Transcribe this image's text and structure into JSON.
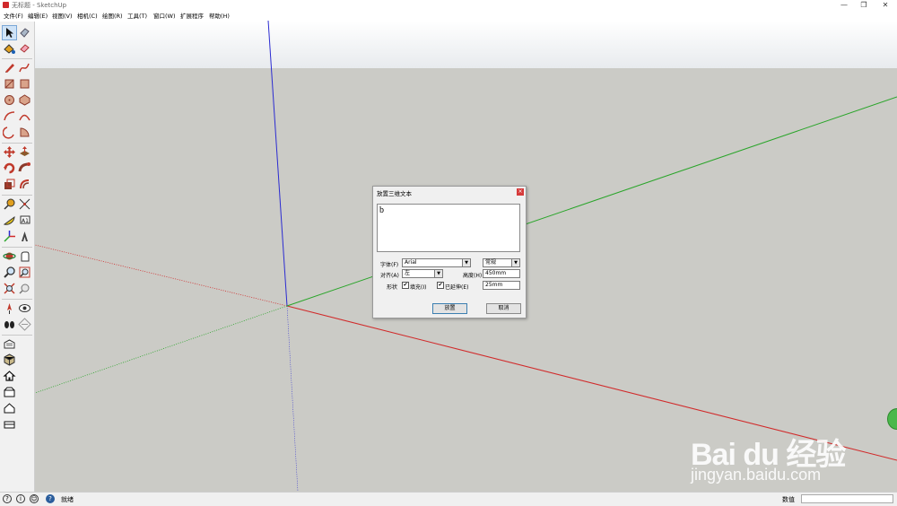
{
  "window": {
    "title": "无标题 - SketchUp",
    "minimize": "—",
    "maximize": "❐",
    "close": "✕"
  },
  "menu": [
    "文件(F)",
    "编辑(E)",
    "视图(V)",
    "相机(C)",
    "绘图(R)",
    "工具(T)",
    "窗口(W)",
    "扩展程序",
    "帮助(H)"
  ],
  "colors": {
    "x_axis": "#d12b2b",
    "y_axis": "#2aa52a",
    "z_axis": "#2b2bd1",
    "ground": "#cbcbc6",
    "sky": "#ffffff"
  },
  "toolbar_icons": [
    "select-icon",
    "eraser-icon",
    "paint-bucket-icon",
    "eraser-pink-icon",
    "pencil-icon",
    "freehand-icon",
    "rectangle-icon",
    "rotated-rectangle-icon",
    "circle-icon",
    "polygon-icon",
    "arc-icon",
    "two-point-arc-icon",
    "three-point-arc-icon",
    "pie-icon",
    "move-icon",
    "push-pull-icon",
    "rotate-icon",
    "follow-me-icon",
    "scale-icon",
    "offset-icon",
    "tape-measure-icon",
    "dimension-icon",
    "protractor-icon",
    "text-icon",
    "axes-icon",
    "3d-text-icon",
    "orbit-icon",
    "pan-icon",
    "zoom-icon",
    "zoom-window-icon",
    "zoom-extents-icon",
    "previous-view-icon",
    "position-camera-icon",
    "look-around-icon",
    "walk-icon",
    "section-plane-icon",
    "warehouse-icon",
    "components-icon",
    "home-view-icon",
    "front-view-icon",
    "top-view-icon",
    "right-view-icon"
  ],
  "dialog": {
    "title": "放置三维文本",
    "close": "×",
    "text_value": "b",
    "font_label": "字体(F)",
    "font_value": "Arial",
    "style_value": "常规",
    "align_label": "对齐(A)",
    "align_value": "左",
    "height_label": "高度(H)",
    "height_value": "450mm",
    "shape_label": "形状",
    "fill_label": "填充(I)",
    "fill_checked": "✔",
    "extrude_label": "已延伸(E)",
    "extrude_checked": "✔",
    "extrude_value": "25mm",
    "place_button": "放置",
    "cancel_button": "取消"
  },
  "status": {
    "text": "就绪",
    "measure_label": "数值"
  },
  "watermark": {
    "logo": "Bai du 经验",
    "sub": "jingyan.baidu.com"
  }
}
